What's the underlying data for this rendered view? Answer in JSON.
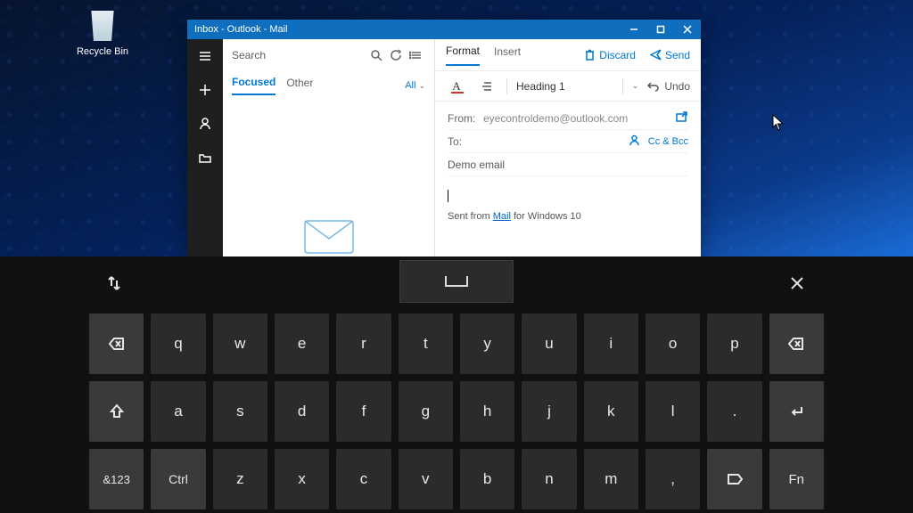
{
  "desktop": {
    "recycle_bin_label": "Recycle Bin"
  },
  "mail": {
    "title": "Inbox - Outlook - Mail",
    "search_placeholder": "Search",
    "tabs": {
      "focused": "Focused",
      "other": "Other"
    },
    "all_filter": "All",
    "compose_tabs": {
      "format": "Format",
      "insert": "Insert"
    },
    "discard": "Discard",
    "send": "Send",
    "heading": "Heading 1",
    "undo": "Undo",
    "from_label": "From:",
    "from_value": "eyecontroldemo@outlook.com",
    "to_label": "To:",
    "cc_bcc": "Cc & Bcc",
    "subject": "Demo email",
    "signature_prefix": "Sent from ",
    "signature_link": "Mail",
    "signature_suffix": " for Windows 10"
  },
  "keyboard": {
    "row1": [
      "q",
      "w",
      "e",
      "r",
      "t",
      "y",
      "u",
      "i",
      "o",
      "p"
    ],
    "row2": [
      "a",
      "s",
      "d",
      "f",
      "g",
      "h",
      "j",
      "k",
      "l",
      "."
    ],
    "row3_sym": "&123",
    "row3_ctrl": "Ctrl",
    "row3": [
      "z",
      "x",
      "c",
      "v",
      "b",
      "n",
      "m",
      ","
    ],
    "row3_fn": "Fn"
  }
}
